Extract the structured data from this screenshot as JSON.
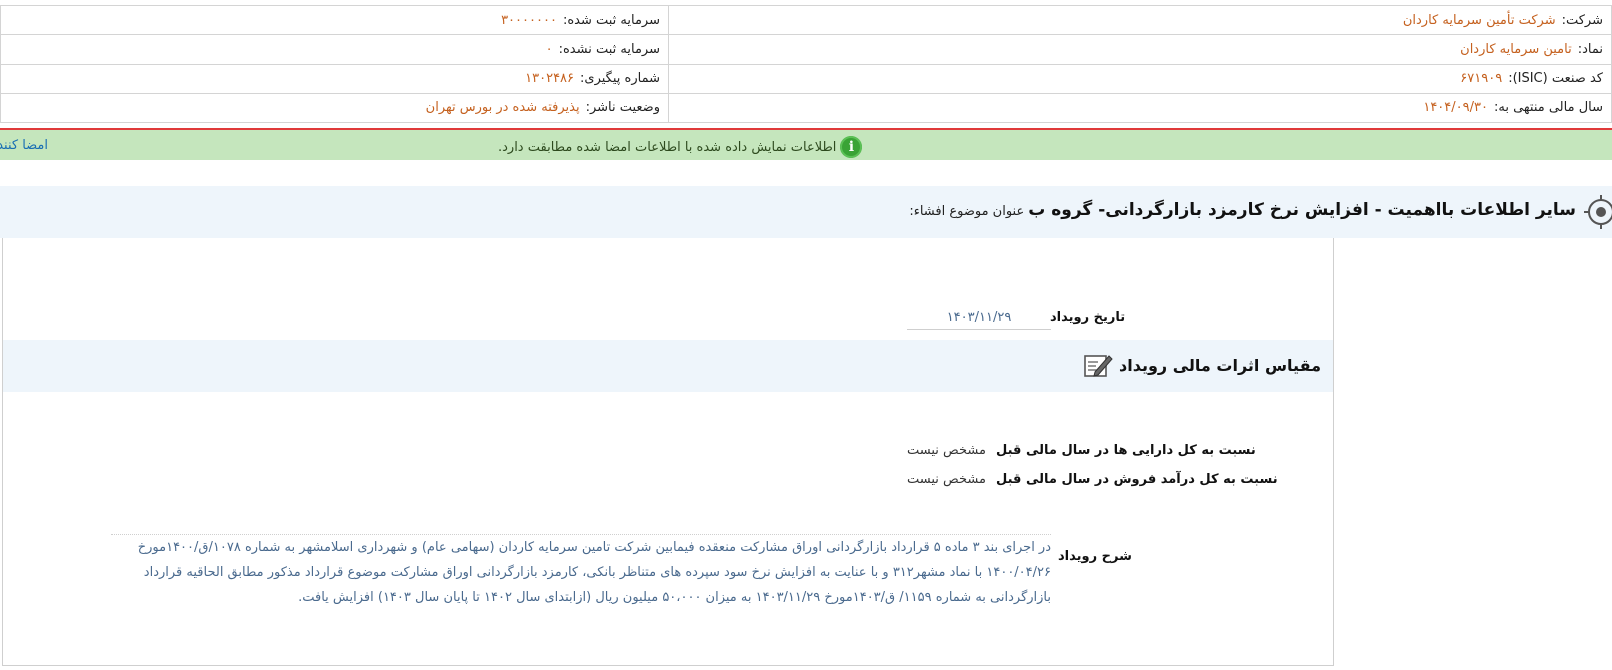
{
  "company_info": {
    "company_label": "شرکت:",
    "company_value": "شرکت تأمین سرمایه کاردان",
    "registered_capital_label": "سرمایه ثبت شده:",
    "registered_capital_value": "۳۰۰۰۰۰۰۰",
    "symbol_label": "نماد:",
    "symbol_value": "تامین سرمایه کاردان",
    "unregistered_capital_label": "سرمایه ثبت نشده:",
    "unregistered_capital_value": "۰",
    "isic_label": "کد صنعت (ISIC):",
    "isic_value": "۶۷۱۹۰۹",
    "tracking_label": "شماره پیگیری:",
    "tracking_value": "۱۳۰۲۴۸۶",
    "fiscal_year_label": "سال مالی منتهی به:",
    "fiscal_year_value": "۱۴۰۴/۰۹/۳۰",
    "publisher_status_label": "وضعیت ناشر:",
    "publisher_status_value": "پذیرفته شده در بورس تهران"
  },
  "verification": {
    "icon": "info-icon",
    "message": "اطلاعات نمایش داده شده با اطلاعات امضا شده مطابقت دارد.",
    "signers_link": "امضا کنندگان"
  },
  "subject": {
    "label": "عنوان موضوع افشاء:",
    "title": "سایر اطلاعات بااهمیت - افزایش نرخ کارمزد بازارگردانی- گروه ب"
  },
  "event": {
    "date_label": "تاریخ رویداد",
    "date_value": "۱۴۰۳/۱۱/۲۹",
    "impact_title": "مقیاس اثرات مالی رویداد",
    "assets_ratio_label": "نسبت به کل دارایی ها در سال مالی قبل",
    "assets_ratio_value": "مشخص نیست",
    "revenue_ratio_label": "نسبت به کل درآمد فروش در سال مالی قبل",
    "revenue_ratio_value": "مشخص نیست",
    "description_label": "شرح رویداد",
    "description_text": "در اجرای بند ۳ ماده ۵ قرارداد بازارگردانی اوراق مشارکت منعقده فیمابین شرکت تامین سرمایه کاردان (سهامی عام) و شهرداری اسلامشهر به شماره ۱۰۷۸/ق/۱۴۰۰مورخ ۱۴۰۰/۰۴/۲۶ با نماد مشهر۳۱۲ و با عنایت به افزایش نرخ سود سپرده های متناظر بانکی، کارمزد بازارگردانی اوراق مشارکت موضوع قرارداد مذکور مطابق الحاقیه قرارداد بازارگردانی به شماره ۱۱۵۹/ ق/۱۴۰۳مورخ ۱۴۰۳/۱۱/۲۹ به میزان ۵۰،۰۰۰ میلیون ریال (ازابتدای سال ۱۴۰۲ تا پایان سال ۱۴۰۳) افزایش یافت."
  }
}
